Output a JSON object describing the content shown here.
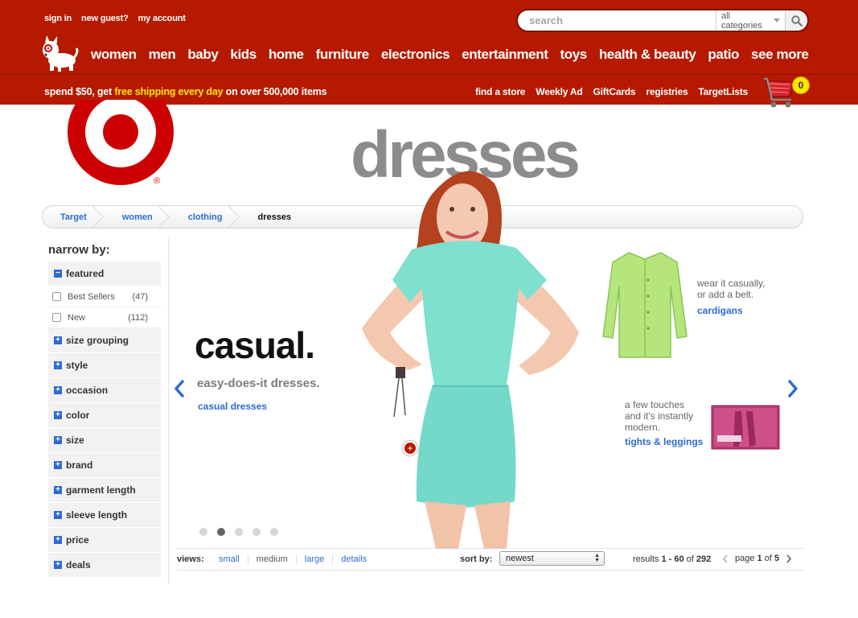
{
  "header": {
    "util_links": [
      "sign in",
      "new guest?",
      "my account"
    ],
    "search": {
      "placeholder": "search",
      "category": "all categories"
    },
    "nav": [
      "women",
      "men",
      "baby",
      "kids",
      "home",
      "furniture",
      "electronics",
      "entertainment",
      "toys",
      "health & beauty",
      "patio",
      "see more"
    ],
    "promo": {
      "pre": "spend $50, get ",
      "highlight": "free shipping every day",
      "post": " on over 500,000 items"
    },
    "sub_links": [
      "find a store",
      "Weekly Ad",
      "GiftCards",
      "registries",
      "TargetLists"
    ],
    "cart_count": "0"
  },
  "logo_mark": "®",
  "page_title": "dresses",
  "breadcrumb": [
    "Target",
    "women",
    "clothing",
    "dresses"
  ],
  "sidebar": {
    "title": "narrow by:",
    "featured": {
      "label": "featured",
      "options": [
        {
          "label": "Best Sellers",
          "count": "(47)"
        },
        {
          "label": "New",
          "count": "(112)"
        }
      ]
    },
    "facets": [
      "size grouping",
      "style",
      "occasion",
      "color",
      "size",
      "brand",
      "garment length",
      "sleeve length",
      "price",
      "deals"
    ]
  },
  "hero": {
    "headline": "casual.",
    "tagline": "easy-does-it dresses.",
    "link": "casual dresses",
    "note1": {
      "line1": "wear it casually,",
      "line2": "or add a belt.",
      "link": "cardigans"
    },
    "note2": {
      "line1": "a few touches",
      "line2": "and it's instantly",
      "line3": "modern.",
      "link": "tights & leggings"
    },
    "slides": 5,
    "active_slide": 2
  },
  "listing": {
    "views_label": "views:",
    "views": [
      "small",
      "medium",
      "large",
      "details"
    ],
    "selected_view": "medium",
    "sort_label": "sort by:",
    "sort_value": "newest",
    "results": {
      "pre": "results ",
      "range": "1 - 60",
      "mid": " of ",
      "total": "292"
    },
    "page": {
      "pre": "page ",
      "current": "1",
      "mid": " of ",
      "total": "5"
    }
  },
  "colors": {
    "brand_red": "#b51a00",
    "link_blue": "#2d6bd0",
    "promo_yellow": "#ffe600",
    "dress_mint": "#7ee0cf"
  }
}
